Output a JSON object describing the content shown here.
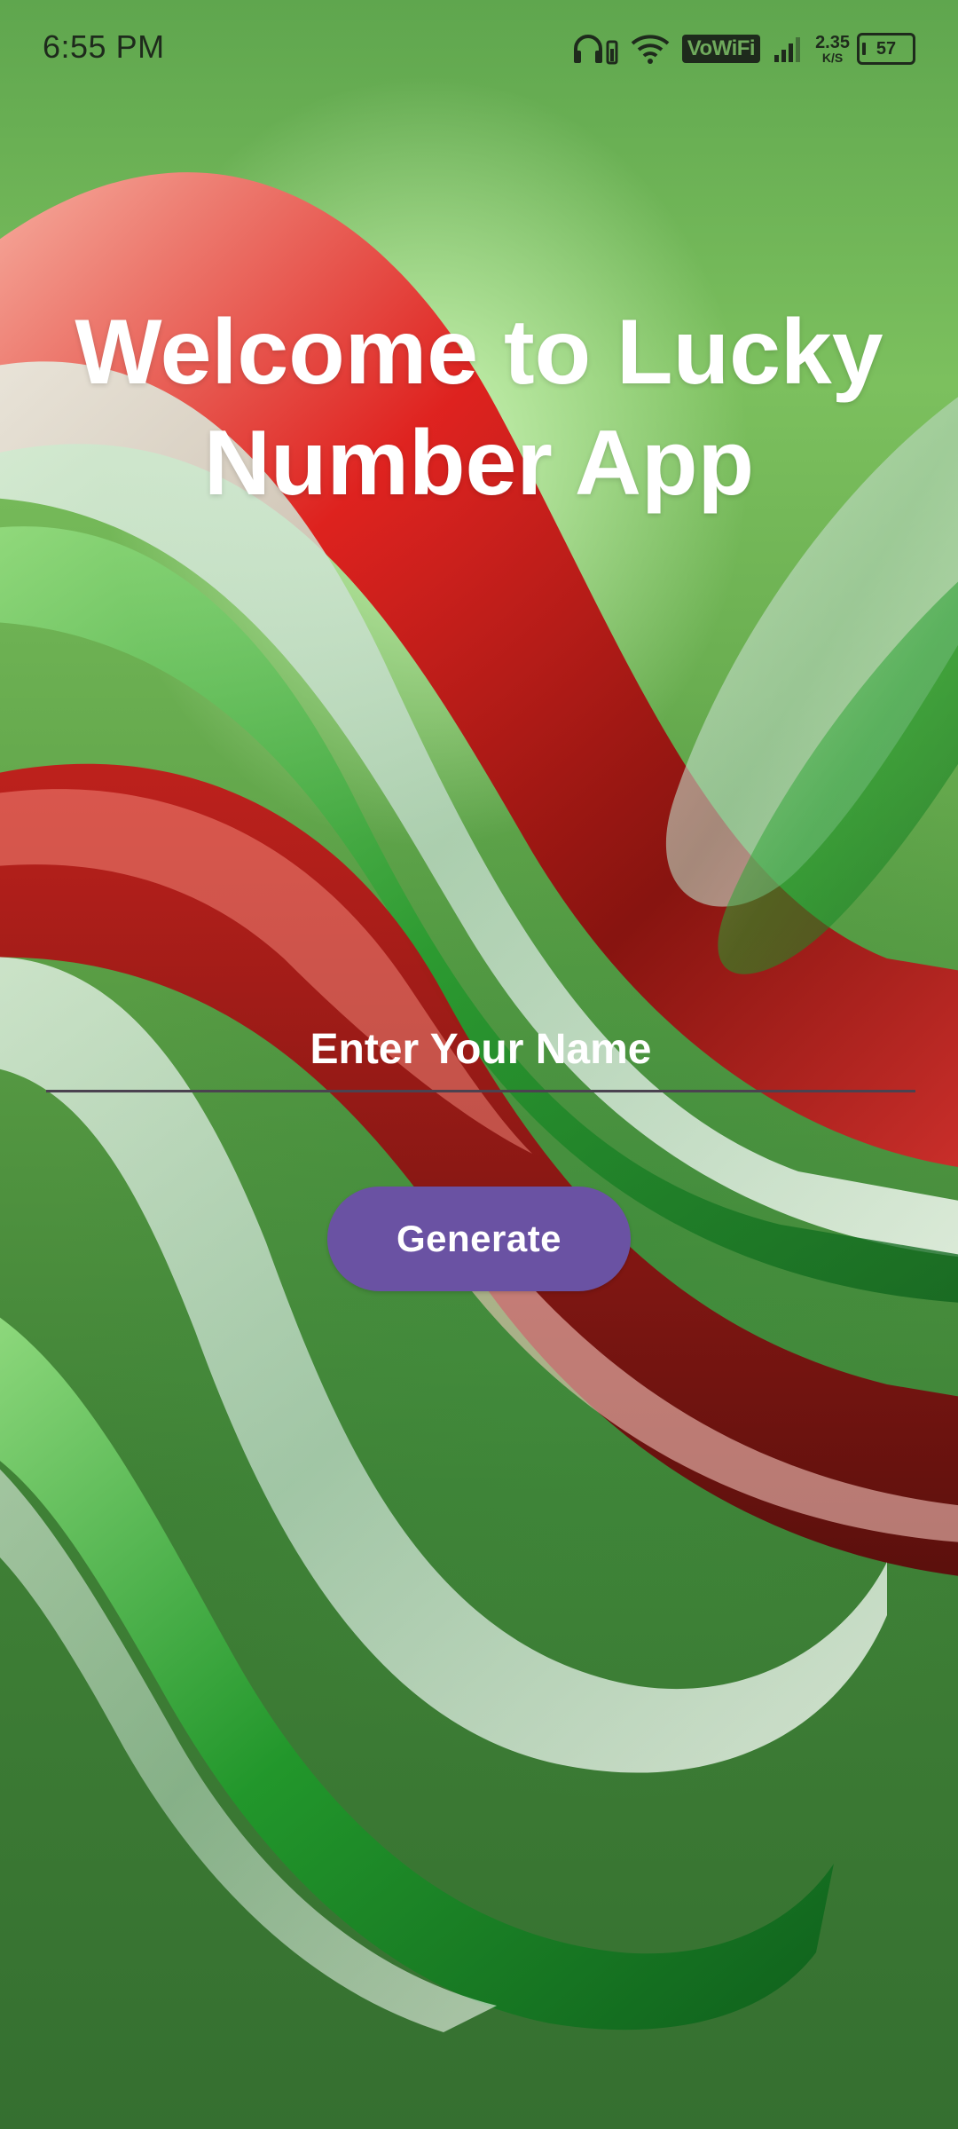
{
  "status_bar": {
    "time": "6:55 PM",
    "vowifi_label": "VoWiFi",
    "network_speed_value": "2.35",
    "network_speed_unit": "K/S",
    "battery_level": "57",
    "icons": [
      "headphones-icon",
      "wifi-icon",
      "vowifi-icon",
      "signal-icon",
      "battery-icon"
    ]
  },
  "main": {
    "title": "Welcome to Lucky Number App",
    "name_input": {
      "value": "",
      "placeholder": "Enter Your Name"
    },
    "generate_button_label": "Generate"
  },
  "colors": {
    "button": "#6a52a3",
    "input_underline": "#4b4250",
    "text": "#ffffff",
    "status_text": "#1e2a1c"
  }
}
